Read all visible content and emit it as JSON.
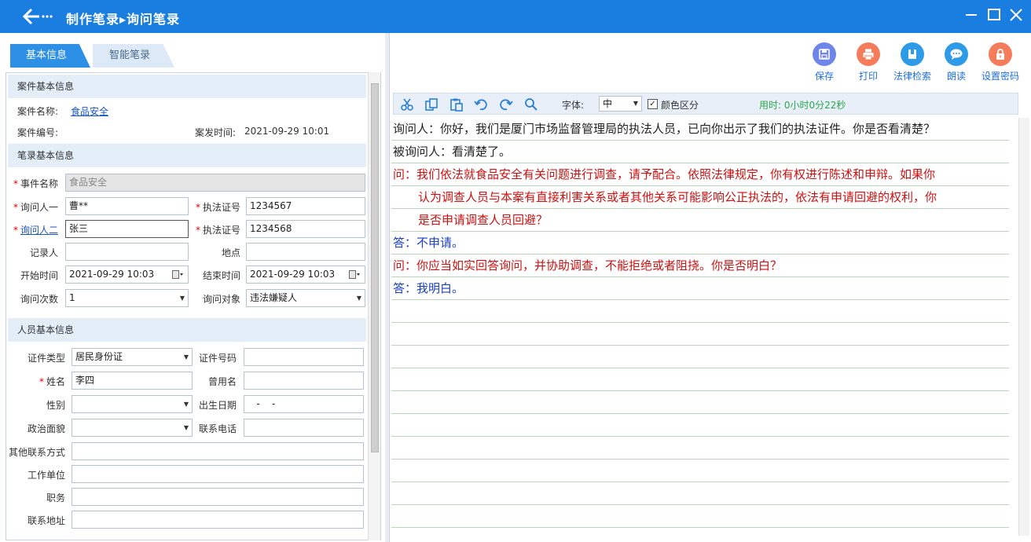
{
  "window": {
    "title": "制作笔录▸询问笔录",
    "back_icon": "arrow-left-icon"
  },
  "tabs": [
    {
      "label": "基本信息",
      "active": true
    },
    {
      "label": "智能笔录",
      "active": false
    }
  ],
  "case_section": {
    "header": "案件基本信息",
    "name_label": "案件名称:",
    "name_value": "食品安全",
    "number_label": "案件编号:",
    "number_value": "",
    "time_label": "案发时间:",
    "time_value": "2021-09-29 10:01"
  },
  "record_section": {
    "header": "笔录基本信息",
    "event_label": "事件名称",
    "event_value": "食品安全",
    "asker1_label": "询问人一",
    "asker1_value": "曹**",
    "cert1_label": "执法证号",
    "cert1_value": "1234567",
    "asker2_label": "询问人二",
    "asker2_value": "张三",
    "cert2_label": "执法证号",
    "cert2_value": "1234568",
    "recorder_label": "记录人",
    "recorder_value": "",
    "place_label": "地点",
    "place_value": "",
    "start_label": "开始时间",
    "start_value": "2021-09-29 10:03",
    "end_label": "结束时间",
    "end_value": "2021-09-29 10:03",
    "count_label": "询问次数",
    "count_value": "1",
    "target_label": "询问对象",
    "target_value": "违法嫌疑人"
  },
  "person_section": {
    "header": "人员基本信息",
    "idtype_label": "证件类型",
    "idtype_value": "居民身份证",
    "idno_label": "证件号码",
    "idno_value": "",
    "name_label": "姓名",
    "name_value": "李四",
    "alias_label": "曾用名",
    "alias_value": "",
    "gender_label": "性别",
    "gender_value": "",
    "birth_label": "出生日期",
    "birth_value": "   -    -",
    "political_label": "政治面貌",
    "political_value": "",
    "phone_label": "联系电话",
    "phone_value": "",
    "other_label": "其他联系方式",
    "other_value": "",
    "work_label": "工作单位",
    "work_value": "",
    "duty_label": "职务",
    "duty_value": "",
    "address_label": "联系地址",
    "address_value": ""
  },
  "actions": [
    {
      "label": "保存",
      "icon": "save-icon",
      "color": "#6f86e8"
    },
    {
      "label": "打印",
      "icon": "print-icon",
      "color": "#f47c5a"
    },
    {
      "label": "法律检索",
      "icon": "book-icon",
      "color": "#2e9be8"
    },
    {
      "label": "朗读",
      "icon": "chat-icon",
      "color": "#2e9be8"
    },
    {
      "label": "设置密码",
      "icon": "lock-icon",
      "color": "#f47c5a"
    }
  ],
  "editor_toolbar": {
    "font_label": "字体:",
    "font_value": "中",
    "color_label": "颜色区分",
    "color_checked": true,
    "elapsed": "用时: 0小时0分22秒"
  },
  "transcript": [
    {
      "text": "询问人：你好，我们是厦门市场监督管理局的执法人员，已向你出示了我们的执法证件。你是否看清楚？",
      "color": "#222222"
    },
    {
      "text": "被询问人：看清楚了。",
      "color": "#222222"
    },
    {
      "text": "问：我们依法就食品安全有关问题进行调查，请予配合。依照法律规定，你有权进行陈述和申辩。如果你",
      "color": "#cc1111"
    },
    {
      "text": "认为调查人员与本案有直接利害关系或者其他关系可能影响公正执法的，依法有申请回避的权利，你",
      "color": "#cc1111",
      "indent": true
    },
    {
      "text": "是否申请调查人员回避？",
      "color": "#cc1111",
      "indent": true
    },
    {
      "text": "答：不申请。",
      "color": "#1a3fbf"
    },
    {
      "text": "问：你应当如实回答询问，并协助调查，不能拒绝或者阻挠。你是否明白？",
      "color": "#cc1111"
    },
    {
      "text": "答：我明白。",
      "color": "#1a3fbf"
    }
  ]
}
